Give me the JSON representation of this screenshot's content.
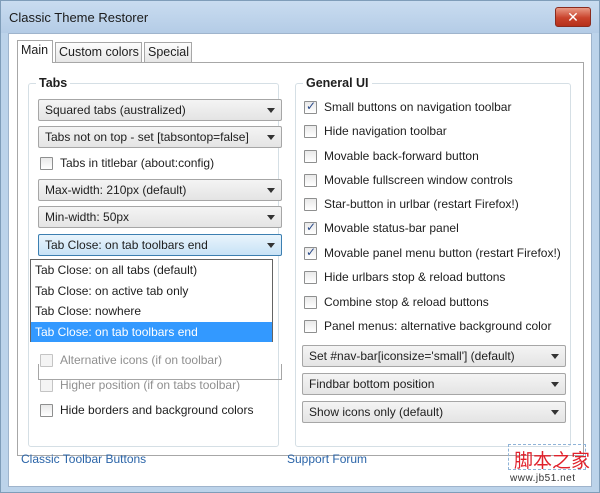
{
  "window": {
    "title": "Classic Theme Restorer",
    "close_label": "✕"
  },
  "tabs": [
    {
      "label": "Main",
      "active": true
    },
    {
      "label": "Custom colors",
      "active": false
    },
    {
      "label": "Special",
      "active": false
    }
  ],
  "tabs_group": {
    "title": "Tabs",
    "tab_shape_select": "Squared tabs (australized)",
    "tabs_on_top_select": "Tabs not on top - set [tabsontop=false]",
    "tabs_in_titlebar": {
      "label": "Tabs in titlebar (about:config)",
      "checked": false
    },
    "max_width_select": "Max-width: 210px (default)",
    "min_width_select": "Min-width: 50px",
    "tab_close_select": "Tab Close: on tab toolbars end",
    "tab_close_options": [
      {
        "label": "Tab Close: on all tabs (default)",
        "selected": false
      },
      {
        "label": "Tab Close: on active tab only",
        "selected": false
      },
      {
        "label": "Tab Close: nowhere",
        "selected": false
      },
      {
        "label": "Tab Close: on tab toolbars end",
        "selected": true
      }
    ],
    "alt_icons": {
      "label": "Alternative icons (if on toolbar)",
      "checked": false,
      "disabled": true
    },
    "higher_position": {
      "label": "Higher position (if on tabs toolbar)",
      "checked": false,
      "disabled": true
    },
    "hide_borders": {
      "label": "Hide borders and background colors",
      "checked": false
    }
  },
  "general_ui": {
    "title": "General UI",
    "checkboxes": [
      {
        "label": "Small buttons on navigation toolbar",
        "checked": true
      },
      {
        "label": "Hide navigation toolbar",
        "checked": false
      },
      {
        "label": "Movable back-forward button",
        "checked": false
      },
      {
        "label": "Movable fullscreen window controls",
        "checked": false
      },
      {
        "label": "Star-button in urlbar (restart Firefox!)",
        "checked": false
      },
      {
        "label": "Movable status-bar panel",
        "checked": true
      },
      {
        "label": "Movable panel menu button (restart Firefox!)",
        "checked": true
      },
      {
        "label": "Hide urlbars stop & reload buttons",
        "checked": false
      },
      {
        "label": "Combine stop & reload buttons",
        "checked": false
      },
      {
        "label": "Panel menus: alternative background color",
        "checked": false
      }
    ],
    "iconsize_select": "Set #nav-bar[iconsize='small'] (default)",
    "findbar_select": "Findbar bottom position",
    "show_icons_select": "Show icons only (default)"
  },
  "footer": {
    "left_link": "Classic Toolbar Buttons",
    "mid_link": "Support Forum"
  },
  "watermark": {
    "text": "脚本之家",
    "url": "www.jb51.net"
  }
}
